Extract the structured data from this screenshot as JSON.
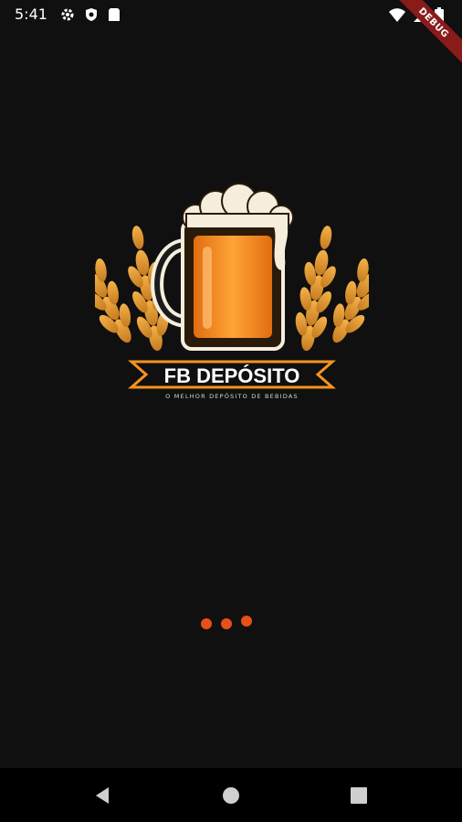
{
  "status_bar": {
    "time": "5:41",
    "icons_left": [
      "gear-icon",
      "shield-icon",
      "sim-card-icon"
    ],
    "icons_right": [
      "wifi-icon",
      "signal-icon",
      "battery-icon"
    ]
  },
  "debug_banner": {
    "label": "DEBUG"
  },
  "logo": {
    "brand_name": "FB DEPÓSITO",
    "tagline": "O MELHOR DEPÓSITO DE BEBIDAS",
    "colors": {
      "beer": "#F7941D",
      "wheat": "#E8A33A",
      "foam": "#F5EEDC",
      "ribbon": "#F7941D"
    }
  },
  "loader": {
    "dot_count": 3,
    "color": "#E8501A"
  },
  "nav_bar": {
    "buttons": [
      "back-icon",
      "home-icon",
      "recents-icon"
    ]
  }
}
